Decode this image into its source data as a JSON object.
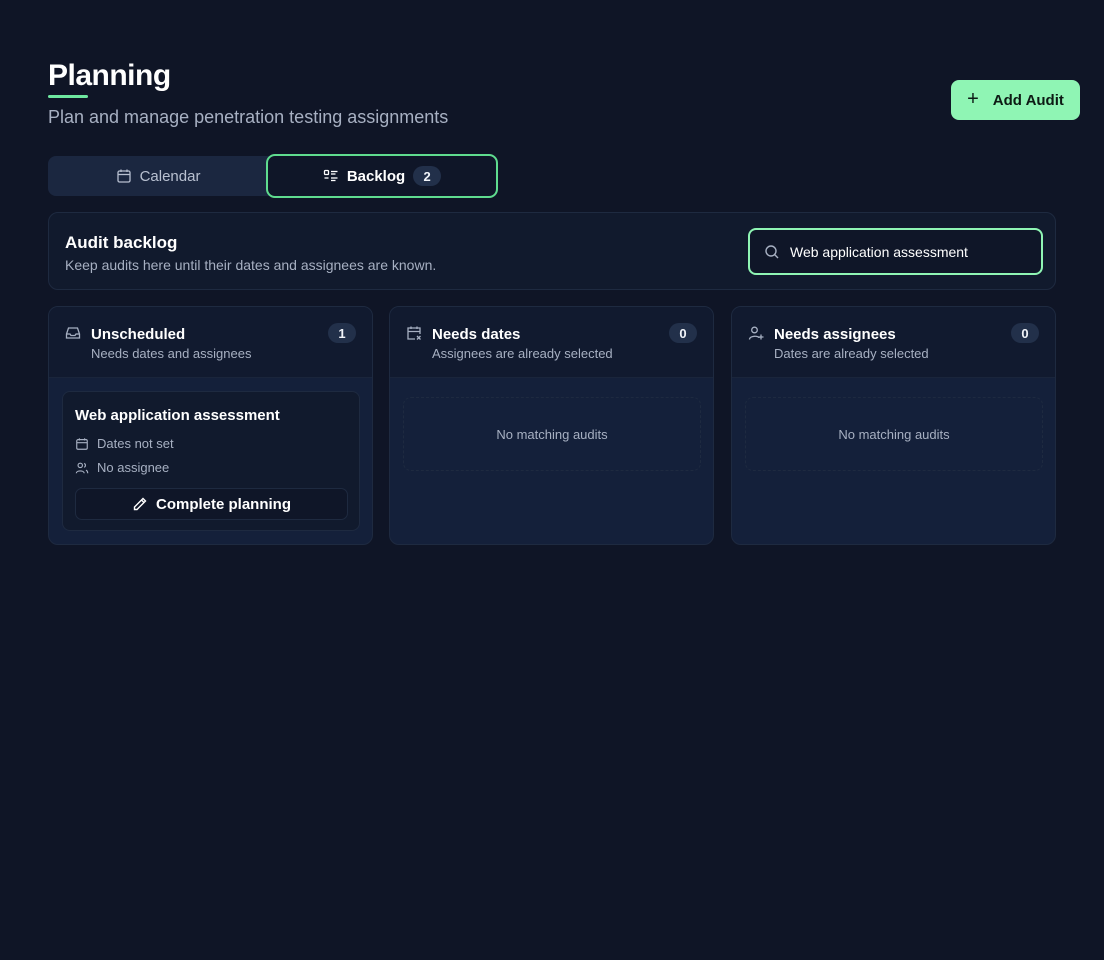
{
  "page": {
    "title": "Planning",
    "subtitle": "Plan and manage penetration testing assignments",
    "add_button_label": "Add Audit"
  },
  "tabs": [
    {
      "label": "Calendar",
      "icon": "calendar-icon",
      "active": false
    },
    {
      "label": "Backlog",
      "icon": "list-icon",
      "badge": "2",
      "active": true
    }
  ],
  "backlog": {
    "title": "Audit backlog",
    "description": "Keep audits here until their dates and assignees are known.",
    "search_value": "Web application assessment"
  },
  "columns": [
    {
      "title": "Unscheduled",
      "subtitle": "Needs dates and assignees",
      "count": "1",
      "icon": "inbox-icon",
      "items": [
        {
          "title": "Web application assessment",
          "dates": "Dates not set",
          "assignee": "No assignee",
          "action_label": "Complete planning"
        }
      ]
    },
    {
      "title": "Needs dates",
      "subtitle": "Assignees are already selected",
      "count": "0",
      "icon": "calendar-x-icon",
      "empty_text": "No matching audits"
    },
    {
      "title": "Needs assignees",
      "subtitle": "Dates are already selected",
      "count": "0",
      "icon": "user-plus-icon",
      "empty_text": "No matching audits"
    }
  ],
  "colors": {
    "background": "#0f1526",
    "accent": "#8ff5b4",
    "accent_border": "#5fdc8f",
    "card": "#14203a",
    "muted_text": "#a7b0c2"
  }
}
